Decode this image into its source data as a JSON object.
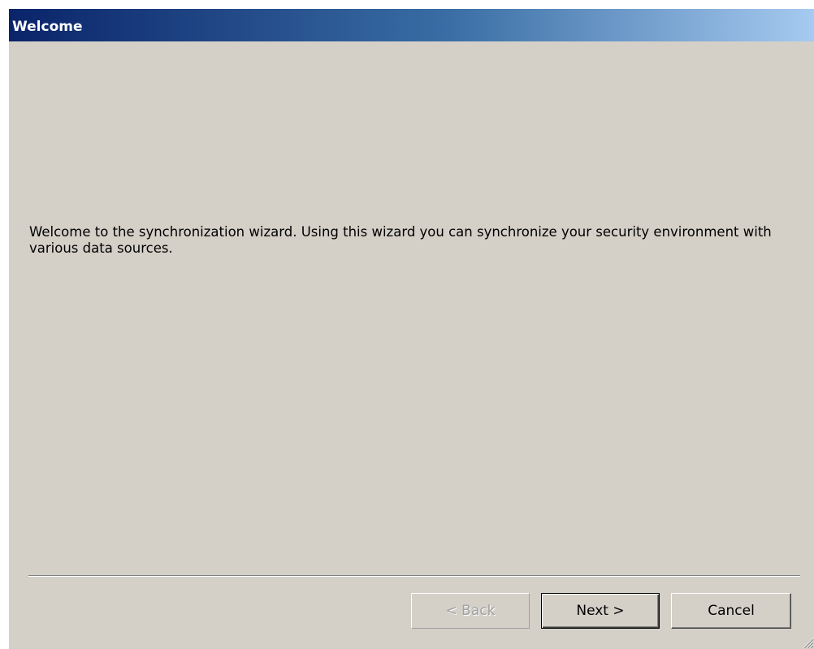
{
  "window": {
    "title": "Welcome"
  },
  "content": {
    "message": "Welcome to the synchronization wizard. Using this wizard you can synchronize your security environment with various data sources."
  },
  "buttons": {
    "back_label": "< Back",
    "back_enabled": false,
    "next_label": "Next >",
    "next_default": true,
    "cancel_label": "Cancel"
  },
  "icons": {
    "resize_grip": "resize-grip-icon"
  },
  "colors": {
    "title_gradient_start": "#0a246a",
    "title_gradient_end": "#a6caf0",
    "dialog_background": "#d4d0c8",
    "disabled_text": "#a0a0a0"
  }
}
